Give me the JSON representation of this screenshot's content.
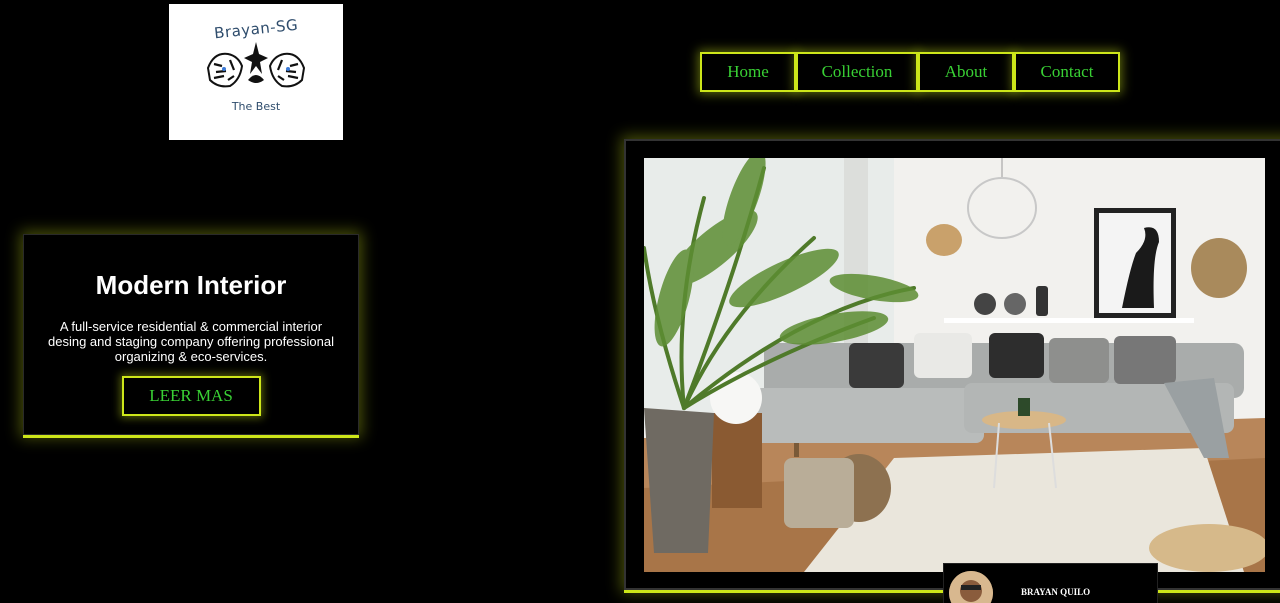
{
  "logo": {
    "top_text": "Brayan-SG",
    "bottom_text": "The Best",
    "icon": "tiger-logo-icon"
  },
  "nav": {
    "items": [
      {
        "label": "Home"
      },
      {
        "label": "Collection"
      },
      {
        "label": "About"
      },
      {
        "label": "Contact"
      }
    ]
  },
  "hero": {
    "title": "Modern Interior",
    "description": "A full-service residential & commercial interior desing and staging company offering professional organizing & eco-services.",
    "button_label": "LEER MAS"
  },
  "showcase": {
    "image": "living-room-photo"
  },
  "profile": {
    "name": "BRAYAN QUILO",
    "avatar": "avatar-icon"
  },
  "colors": {
    "background": "#000000",
    "accent_glow": "#cde61a",
    "link_green": "#39d034"
  }
}
